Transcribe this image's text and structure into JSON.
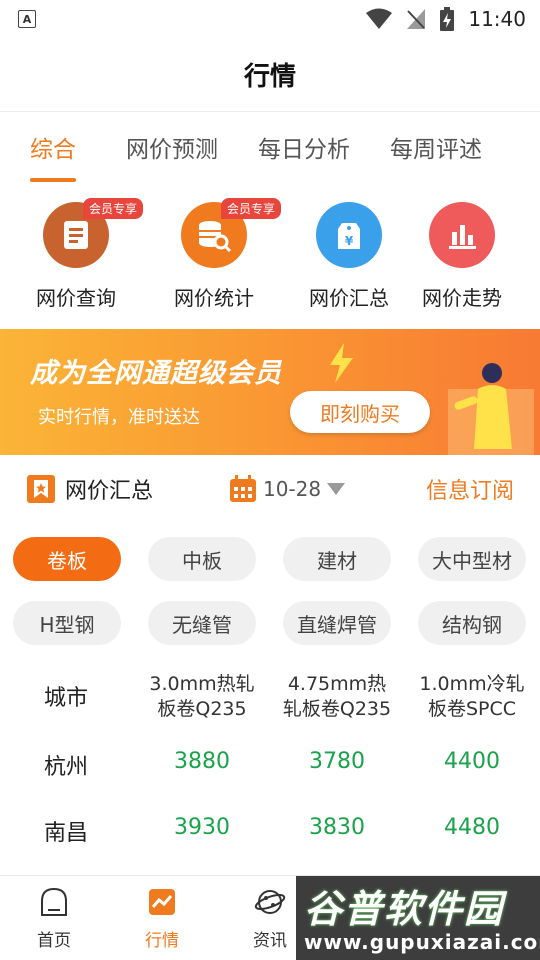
{
  "status_bar": {
    "time": "11:40",
    "indicator": "A"
  },
  "header": {
    "title": "行情"
  },
  "tabs": [
    {
      "label": "综合",
      "active": true
    },
    {
      "label": "网价预测",
      "active": false
    },
    {
      "label": "每日分析",
      "active": false
    },
    {
      "label": "每周评述",
      "active": false
    }
  ],
  "quick_actions": [
    {
      "label": "网价查询",
      "badge": "会员专享",
      "icon": "document-icon",
      "color": "#c8632f"
    },
    {
      "label": "网价统计",
      "badge": "会员专享",
      "icon": "database-search-icon",
      "color": "#f07a1e"
    },
    {
      "label": "网价汇总",
      "badge": "",
      "icon": "price-tag-icon",
      "color": "#3aa0ea"
    },
    {
      "label": "网价走势",
      "badge": "",
      "icon": "bar-chart-icon",
      "color": "#ef5a5a"
    }
  ],
  "banner": {
    "title": "成为全网通超级会员",
    "subtitle": "实时行情，准时送达",
    "button": "即刻购买"
  },
  "section": {
    "title": "网价汇总",
    "date": "10-28",
    "subscribe": "信息订阅"
  },
  "categories": [
    {
      "label": "卷板",
      "active": true
    },
    {
      "label": "中板",
      "active": false
    },
    {
      "label": "建材",
      "active": false
    },
    {
      "label": "大中型材",
      "active": false
    },
    {
      "label": "H型钢",
      "active": false
    },
    {
      "label": "无缝管",
      "active": false
    },
    {
      "label": "直缝焊管",
      "active": false
    },
    {
      "label": "结构钢",
      "active": false
    }
  ],
  "table": {
    "city_header": "城市",
    "columns": [
      {
        "line1": "3.0mm热轧",
        "line2": "板卷Q235"
      },
      {
        "line1": "4.75mm热",
        "line2": "轧板卷Q235"
      },
      {
        "line1": "1.0mm冷轧",
        "line2": "板卷SPCC"
      }
    ],
    "rows": [
      {
        "city": "杭州",
        "values": [
          "3880",
          "3780",
          "4400"
        ]
      },
      {
        "city": "南昌",
        "values": [
          "3930",
          "3830",
          "4480"
        ]
      }
    ]
  },
  "bottom_nav": [
    {
      "label": "首页",
      "icon": "home-icon",
      "active": false
    },
    {
      "label": "行情",
      "icon": "market-chart-icon",
      "active": true
    },
    {
      "label": "资讯",
      "icon": "news-planet-icon",
      "active": false
    }
  ],
  "watermark": {
    "text": "谷普软件园",
    "url": "www.gupuxiazai.com"
  },
  "colors": {
    "accent": "#f07a1e",
    "price_green": "#1aa34a",
    "vip_red": "#e8453c"
  }
}
